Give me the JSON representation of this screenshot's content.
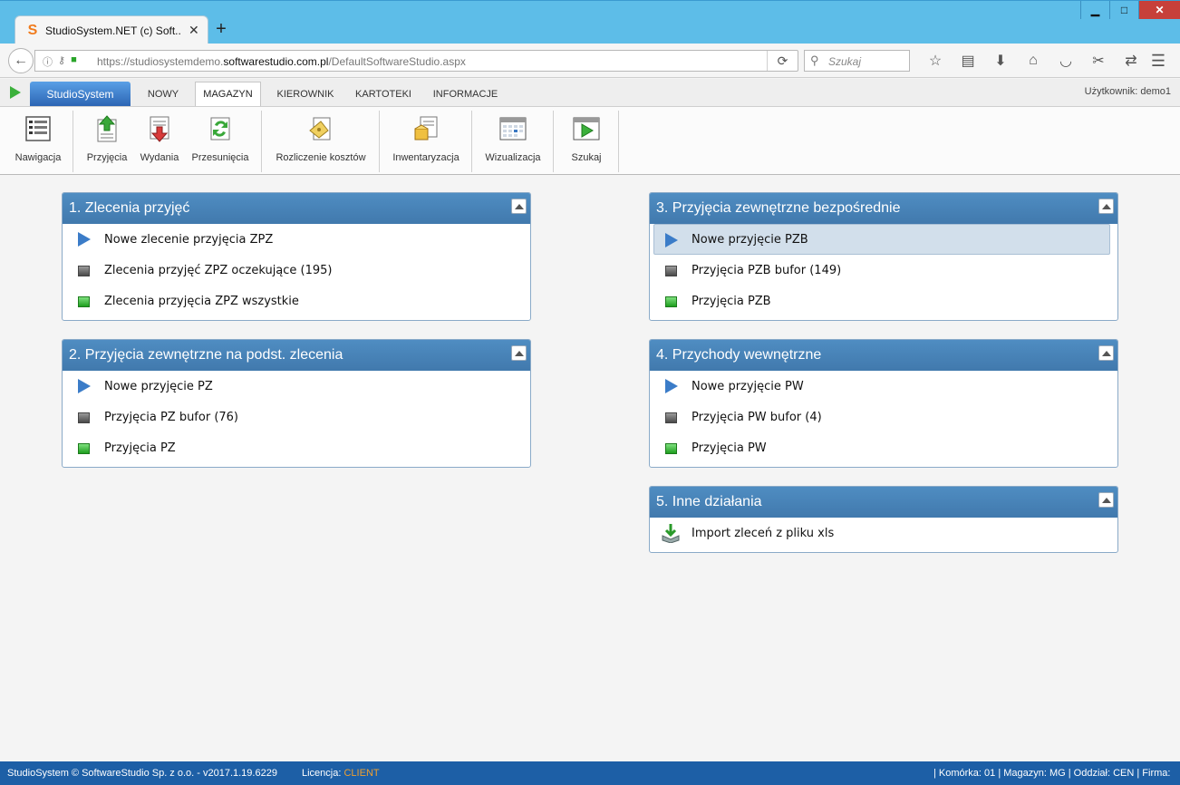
{
  "browser": {
    "tab_title": "StudioSystem.NET (c) Soft...",
    "url_prefix": "https://studiosystemdemo.",
    "url_domain": "softwarestudio.com.pl",
    "url_path": "/DefaultSoftwareStudio.aspx",
    "search_placeholder": "Szukaj"
  },
  "app": {
    "main_tab": "StudioSystem",
    "tabs": [
      "NOWY",
      "MAGAZYN",
      "KIEROWNIK",
      "KARTOTEKI",
      "INFORMACJE"
    ],
    "active_tab": "MAGAZYN",
    "user_label": "Użytkownik: demo1"
  },
  "ribbon": {
    "nawigacja": "Nawigacja",
    "przyjecia": "Przyjęcia",
    "wydania": "Wydania",
    "przesuniecia": "Przesunięcia",
    "rozliczenie": "Rozliczenie kosztów",
    "inwentaryzacja": "Inwentaryzacja",
    "wizualizacja": "Wizualizacja",
    "szukaj": "Szukaj"
  },
  "panels": {
    "p1": {
      "title": "1. Zlecenia przyjęć",
      "items": [
        "Nowe zlecenie przyjęcia ZPZ",
        "Zlecenia przyjęć ZPZ oczekujące (195)",
        "Zlecenia przyjęcia ZPZ wszystkie"
      ]
    },
    "p2": {
      "title": "2. Przyjęcia zewnętrzne na podst. zlecenia",
      "items": [
        "Nowe przyjęcie PZ",
        "Przyjęcia PZ bufor (76)",
        "Przyjęcia PZ"
      ]
    },
    "p3": {
      "title": "3. Przyjęcia zewnętrzne bezpośrednie",
      "items": [
        "Nowe przyjęcie PZB",
        "Przyjęcia PZB bufor (149)",
        "Przyjęcia PZB"
      ]
    },
    "p4": {
      "title": "4. Przychody wewnętrzne",
      "items": [
        "Nowe przyjęcie PW",
        "Przyjęcia PW bufor (4)",
        "Przyjęcia PW"
      ]
    },
    "p5": {
      "title": "5. Inne działania",
      "items": [
        "Import zleceń z pliku xls"
      ]
    }
  },
  "footer": {
    "copyright": "StudioSystem © SoftwareStudio Sp. z o.o. - v2017.1.19.6229",
    "license_label": "Licencja:",
    "license_value": "CLIENT",
    "status": "| Komórka: 01 | Magazyn: MG | Oddział: CEN | Firma:"
  },
  "colors": {
    "panel_header": "#4a84b8",
    "footer": "#1d5fa6",
    "titlebar": "#5dbde8",
    "license_value": "#f0a030"
  }
}
